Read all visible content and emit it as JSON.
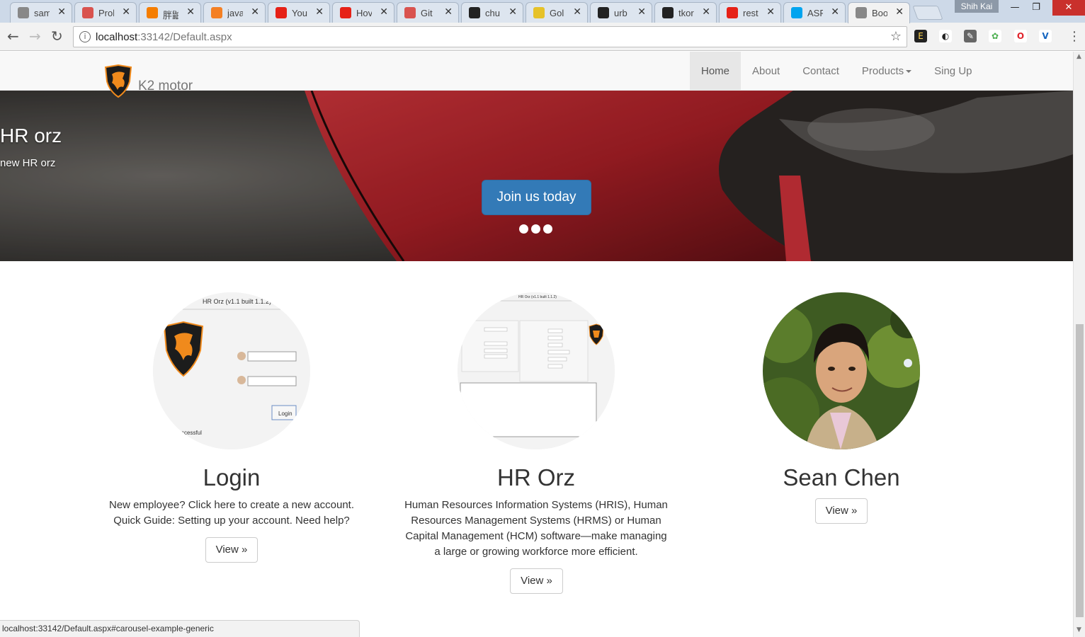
{
  "browser": {
    "tabs": [
      {
        "title": "sam",
        "icon": "page-icon",
        "color": "#888888"
      },
      {
        "title": "Prol",
        "icon": "problem-icon",
        "color": "#d9534f"
      },
      {
        "title": "胖鼬",
        "icon": "blogger-icon",
        "color": "#f57d00"
      },
      {
        "title": "java",
        "icon": "stackoverflow-icon",
        "color": "#f48024"
      },
      {
        "title": "You",
        "icon": "youtube-icon",
        "color": "#e62117"
      },
      {
        "title": "Hov",
        "icon": "youtube-icon",
        "color": "#e62117"
      },
      {
        "title": "Git",
        "icon": "git-icon",
        "color": "#d9534f"
      },
      {
        "title": "chu",
        "icon": "github-icon",
        "color": "#222222"
      },
      {
        "title": "Gol",
        "icon": "gold-icon",
        "color": "#e6c229"
      },
      {
        "title": "urb",
        "icon": "github-icon",
        "color": "#222222"
      },
      {
        "title": "tkor",
        "icon": "github-icon",
        "color": "#222222"
      },
      {
        "title": "rest",
        "icon": "youtube-icon",
        "color": "#e62117"
      },
      {
        "title": "ASP",
        "icon": "microsoft-icon",
        "color": "#00a4ef"
      },
      {
        "title": "Boo",
        "icon": "page-icon",
        "color": "#888888"
      }
    ],
    "profile_name": "Shih Kai",
    "url_host": "localhost",
    "url_path": ":33142/Default.aspx",
    "status_url": "localhost:33142/Default.aspx#carousel-example-generic"
  },
  "site": {
    "brand": "K2 motor",
    "nav": [
      {
        "label": "Home",
        "active": true
      },
      {
        "label": "About",
        "active": false
      },
      {
        "label": "Contact",
        "active": false
      },
      {
        "label": "Products",
        "active": false,
        "dropdown": true
      },
      {
        "label": "Sing Up",
        "active": false
      }
    ],
    "carousel": {
      "title": "HR orz",
      "subtitle": "new HR orz",
      "button": "Join us today",
      "slides": 3,
      "active_slide": 1
    },
    "columns": [
      {
        "heading": "Login",
        "text": [
          "New employee? Click here to create a new account.",
          "Quick Guide: Setting up your account. Need help?"
        ],
        "button": "View »",
        "image_caption": "HR Orz (v1.1 built 1.1.2)",
        "image_button": "Login",
        "image_status": "ccessful"
      },
      {
        "heading": "HR Orz",
        "text": [
          "Human Resources Information Systems (HRIS), Human",
          "Resources Management Systems (HRMS) or Human",
          "Capital Management (HCM) software—make managing",
          "a large or growing workforce more efficient."
        ],
        "button": "View »",
        "image_caption": "HR Orz (v1.1 built 1.1.2)"
      },
      {
        "heading": "Sean Chen",
        "text": [],
        "button": "View »"
      }
    ]
  }
}
